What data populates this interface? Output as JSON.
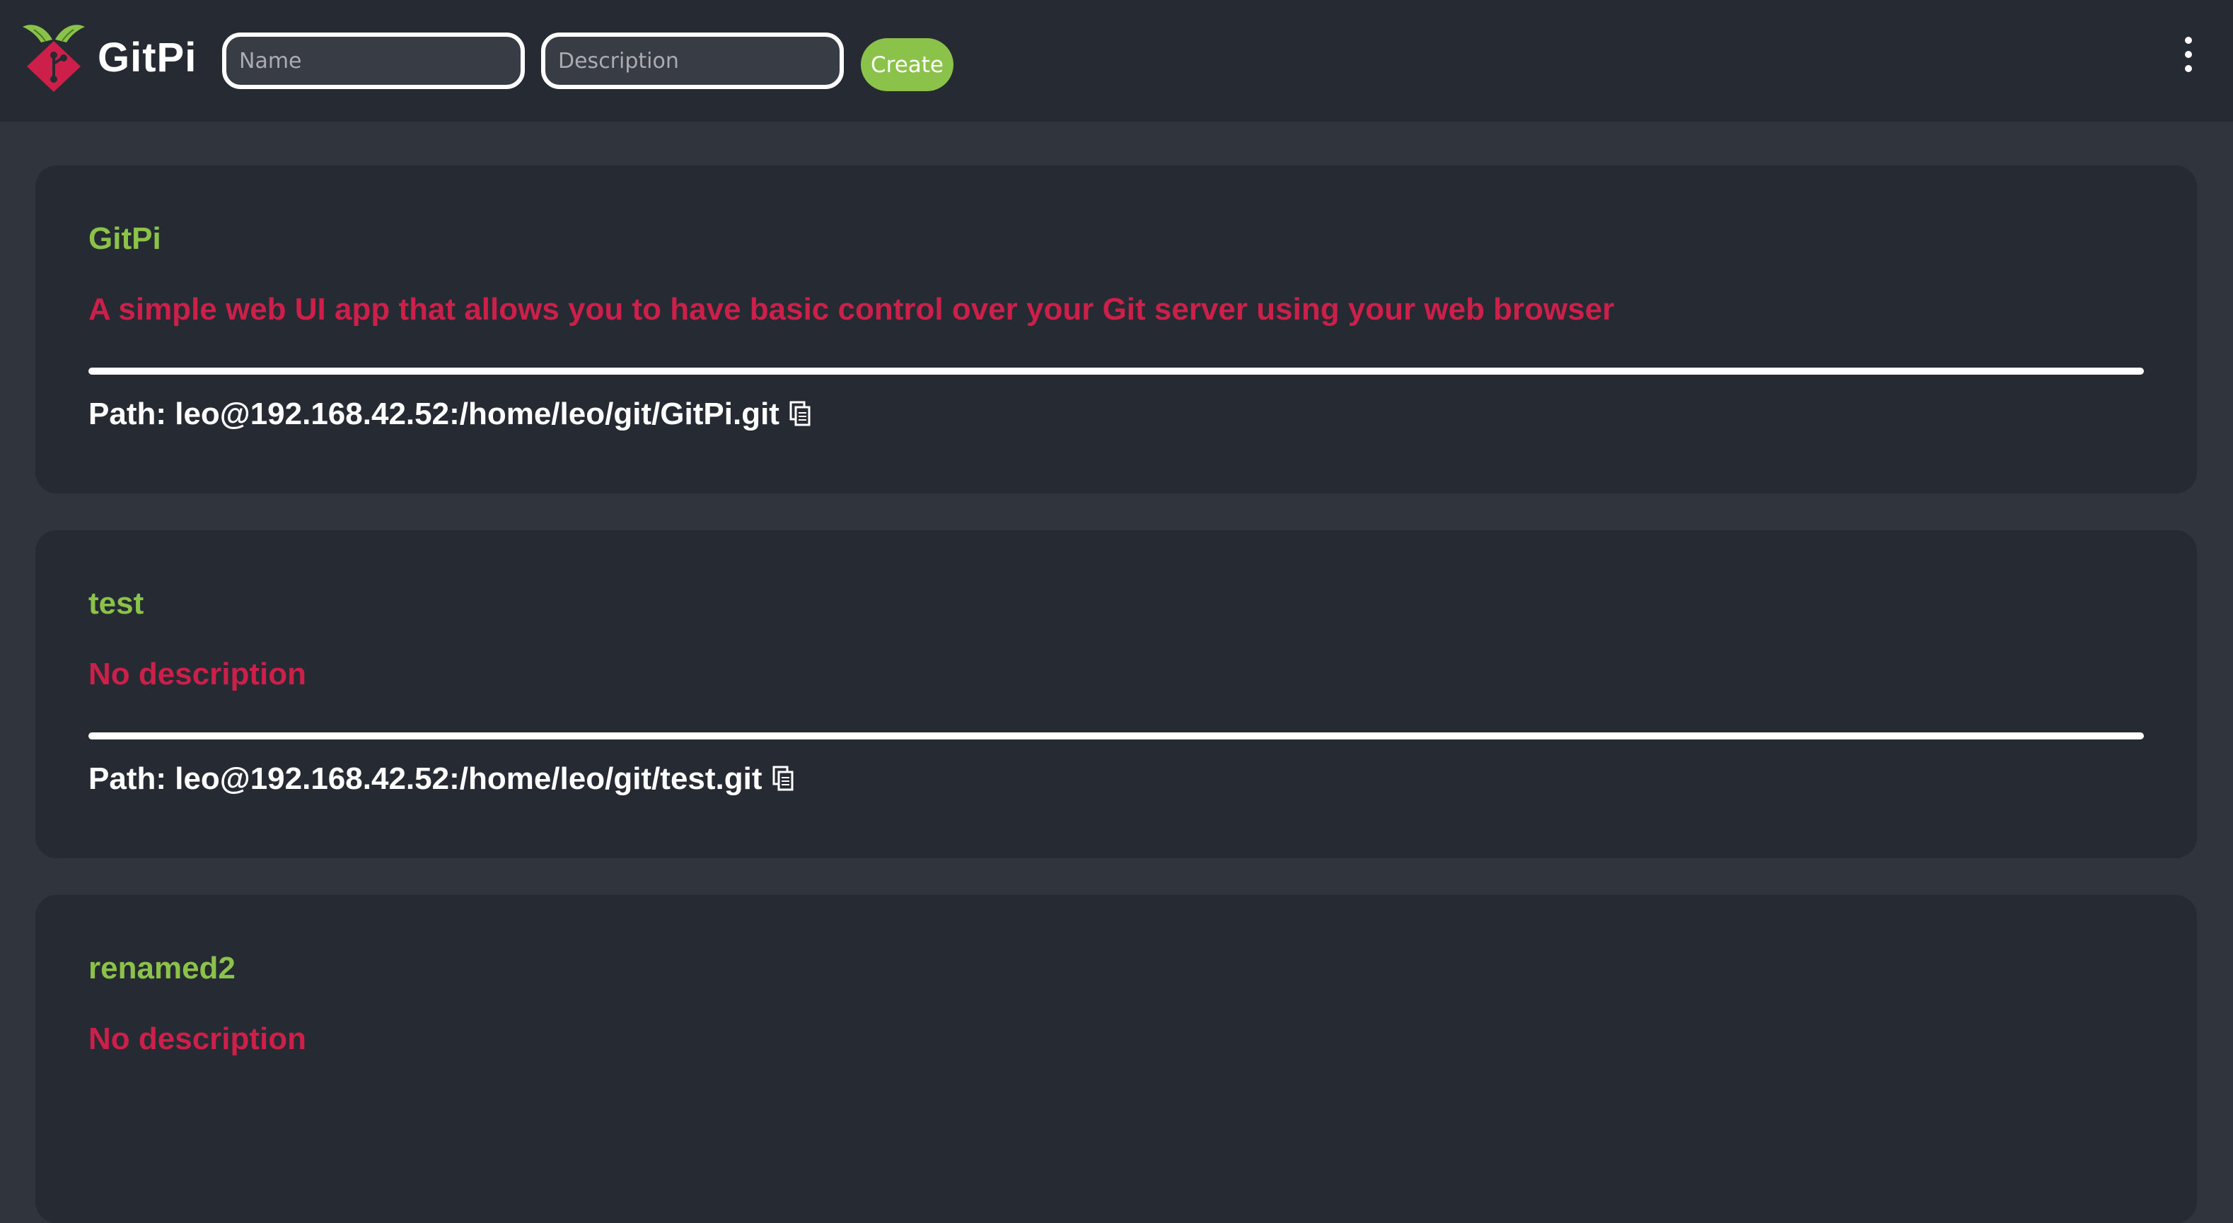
{
  "header": {
    "title": "GitPi",
    "logo_icon": "raspberry-git-logo-icon",
    "name_placeholder": "Name",
    "description_placeholder": "Description",
    "create_label": "Create",
    "menu_icon": "more-vertical-icon"
  },
  "repos": [
    {
      "name": "GitPi",
      "description": "A simple web UI app that allows you to have basic control over your Git server using your web browser",
      "path": "Path: leo@192.168.42.52:/home/leo/git/GitPi.git"
    },
    {
      "name": "test",
      "description": "No description",
      "path": "Path: leo@192.168.42.52:/home/leo/git/test.git"
    },
    {
      "name": "renamed2",
      "description": "No description"
    }
  ],
  "colors": {
    "topbar": "#262a33",
    "background": "#30343d",
    "card": "#262a33",
    "accent_green": "#8bc34a",
    "accent_red": "#cc1f4a",
    "text": "#ffffff"
  },
  "icons": {
    "copy": "copy-icon"
  }
}
